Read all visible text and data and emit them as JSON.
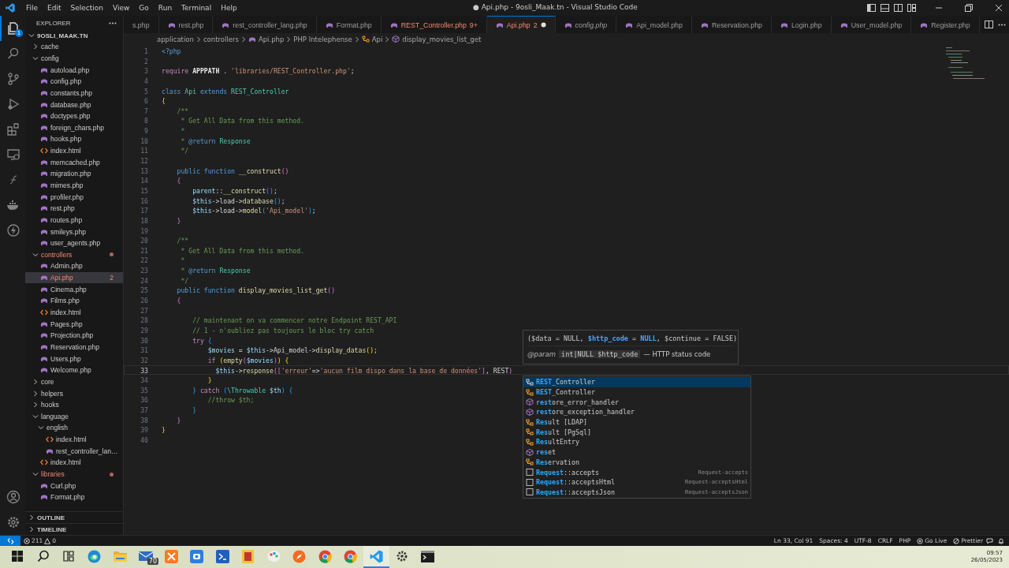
{
  "window": {
    "title": "● Api.php - 9osli_Maak.tn - Visual Studio Code",
    "menu": [
      "File",
      "Edit",
      "Selection",
      "View",
      "Go",
      "Run",
      "Terminal",
      "Help"
    ]
  },
  "activity_bar": [
    {
      "kind": "explorer",
      "selected": true,
      "badge": "1"
    },
    {
      "kind": "search",
      "selected": false
    },
    {
      "kind": "source-control",
      "selected": false
    },
    {
      "kind": "run",
      "selected": false
    },
    {
      "kind": "extensions",
      "selected": false
    },
    {
      "kind": "remote",
      "selected": false
    },
    {
      "kind": "script",
      "selected": false
    },
    {
      "kind": "docker",
      "selected": false
    },
    {
      "kind": "bolt",
      "selected": false
    }
  ],
  "activity_bottom": [
    {
      "kind": "account"
    },
    {
      "kind": "settings"
    }
  ],
  "explorer": {
    "title": "EXPLORER",
    "root": {
      "label": "9OSLI_MAAK.TN",
      "expanded": true
    },
    "tree": [
      {
        "label": "cache",
        "kind": "folder",
        "expanded": false,
        "selected": false,
        "error": false
      },
      {
        "label": "config",
        "kind": "folder",
        "expanded": true,
        "selected": false,
        "error": false,
        "children": [
          {
            "label": "autoload.php",
            "kind": "php",
            "selected": false,
            "error": false
          },
          {
            "label": "config.php",
            "kind": "php",
            "selected": false,
            "error": false
          },
          {
            "label": "constants.php",
            "kind": "php",
            "selected": false,
            "error": false
          },
          {
            "label": "database.php",
            "kind": "php",
            "selected": false,
            "error": false
          },
          {
            "label": "doctypes.php",
            "kind": "php",
            "selected": false,
            "error": false
          },
          {
            "label": "foreign_chars.php",
            "kind": "php",
            "selected": false,
            "error": false
          },
          {
            "label": "hooks.php",
            "kind": "php",
            "selected": false,
            "error": false
          },
          {
            "label": "index.html",
            "kind": "html",
            "selected": false,
            "error": false
          },
          {
            "label": "memcached.php",
            "kind": "php",
            "selected": false,
            "error": false
          },
          {
            "label": "migration.php",
            "kind": "php",
            "selected": false,
            "error": false
          },
          {
            "label": "mimes.php",
            "kind": "php",
            "selected": false,
            "error": false
          },
          {
            "label": "profiler.php",
            "kind": "php",
            "selected": false,
            "error": false
          },
          {
            "label": "rest.php",
            "kind": "php",
            "selected": false,
            "error": false
          },
          {
            "label": "routes.php",
            "kind": "php",
            "selected": false,
            "error": false
          },
          {
            "label": "smileys.php",
            "kind": "php",
            "selected": false,
            "error": false
          },
          {
            "label": "user_agents.php",
            "kind": "php",
            "selected": false,
            "error": false
          }
        ]
      },
      {
        "label": "controllers",
        "kind": "folder",
        "expanded": true,
        "selected": false,
        "error": true,
        "children": [
          {
            "label": "Admin.php",
            "kind": "php",
            "selected": false,
            "error": false
          },
          {
            "label": "Api.php",
            "kind": "php",
            "selected": true,
            "error": true,
            "badge": "2"
          },
          {
            "label": "Cinema.php",
            "kind": "php",
            "selected": false,
            "error": false
          },
          {
            "label": "Films.php",
            "kind": "php",
            "selected": false,
            "error": false
          },
          {
            "label": "index.html",
            "kind": "html",
            "selected": false,
            "error": false
          },
          {
            "label": "Pages.php",
            "kind": "php",
            "selected": false,
            "error": false
          },
          {
            "label": "Projection.php",
            "kind": "php",
            "selected": false,
            "error": false
          },
          {
            "label": "Reservation.php",
            "kind": "php",
            "selected": false,
            "error": false
          },
          {
            "label": "Users.php",
            "kind": "php",
            "selected": false,
            "error": false
          },
          {
            "label": "Welcome.php",
            "kind": "php",
            "selected": false,
            "error": false
          }
        ]
      },
      {
        "label": "core",
        "kind": "folder",
        "expanded": false,
        "selected": false,
        "error": false
      },
      {
        "label": "helpers",
        "kind": "folder",
        "expanded": false,
        "selected": false,
        "error": false
      },
      {
        "label": "hooks",
        "kind": "folder",
        "expanded": false,
        "selected": false,
        "error": false
      },
      {
        "label": "language",
        "kind": "folder",
        "expanded": true,
        "selected": false,
        "error": false,
        "children": [
          {
            "label": "english",
            "kind": "folder",
            "expanded": true,
            "selected": false,
            "error": false,
            "children": [
              {
                "label": "index.html",
                "kind": "html",
                "selected": false,
                "error": false
              },
              {
                "label": "rest_controller_lan…",
                "kind": "php",
                "selected": false,
                "error": false
              }
            ]
          },
          {
            "label": "index.html",
            "kind": "html",
            "selected": false,
            "error": false
          }
        ]
      },
      {
        "label": "libraries",
        "kind": "folder",
        "expanded": true,
        "selected": false,
        "error": true,
        "children": [
          {
            "label": "Curl.php",
            "kind": "php",
            "selected": false,
            "error": false
          },
          {
            "label": "Format.php",
            "kind": "php",
            "selected": false,
            "error": false
          }
        ]
      }
    ],
    "sections": [
      {
        "label": "OUTLINE",
        "expanded": false
      },
      {
        "label": "TIMELINE",
        "expanded": false
      }
    ]
  },
  "tabs": [
    {
      "label": "s.php",
      "icon": false,
      "selected": false,
      "preview": false,
      "error": false,
      "modified": false
    },
    {
      "label": "rest.php",
      "icon": true,
      "selected": false,
      "preview": false,
      "error": false,
      "modified": false
    },
    {
      "label": "rest_controller_lang.php",
      "icon": true,
      "selected": false,
      "preview": false,
      "error": false,
      "modified": false
    },
    {
      "label": "Format.php",
      "icon": true,
      "selected": false,
      "preview": false,
      "error": false,
      "modified": false
    },
    {
      "label": "REST_Controller.php",
      "icon": true,
      "selected": false,
      "preview": false,
      "error": true,
      "badge": "9+",
      "modified": false
    },
    {
      "label": "Api.php",
      "icon": true,
      "selected": true,
      "preview": false,
      "error": true,
      "badge": "2",
      "modified": true
    },
    {
      "label": "config.php",
      "icon": true,
      "selected": false,
      "preview": true,
      "error": false,
      "modified": false
    },
    {
      "label": "Api_model.php",
      "icon": true,
      "selected": false,
      "preview": false,
      "error": false,
      "modified": false
    },
    {
      "label": "Reservation.php",
      "icon": true,
      "selected": false,
      "preview": false,
      "error": false,
      "modified": false
    },
    {
      "label": "Login.php",
      "icon": true,
      "selected": false,
      "preview": false,
      "error": false,
      "modified": false
    },
    {
      "label": "User_model.php",
      "icon": true,
      "selected": false,
      "preview": false,
      "error": false,
      "modified": false
    },
    {
      "label": "Register.php",
      "icon": true,
      "selected": false,
      "preview": false,
      "error": false,
      "modified": false
    }
  ],
  "breadcrumb": [
    {
      "text": "application",
      "kind": "folder"
    },
    {
      "text": "controllers",
      "kind": "folder"
    },
    {
      "text": "Api.php",
      "kind": "php"
    },
    {
      "text": "PHP Intelephense",
      "kind": "folder"
    },
    {
      "text": "Api",
      "kind": "class"
    },
    {
      "text": "display_movies_list_get",
      "kind": "method"
    }
  ],
  "lines": [
    {
      "number": "1",
      "current": false,
      "tokens": [
        {
          "kind": "tag",
          "text": "<?php"
        }
      ]
    },
    {
      "number": "2",
      "current": false
    },
    {
      "number": "3",
      "current": false,
      "tokens": [
        {
          "kind": "control",
          "text": "require "
        },
        {
          "kind": "const",
          "text": "APPPATH"
        },
        {
          "kind": "plain",
          "text": " . "
        },
        {
          "kind": "string",
          "text": "'libraries/REST_Controller.php'"
        },
        {
          "kind": "plain",
          "text": ";"
        }
      ]
    },
    {
      "number": "4",
      "current": false
    },
    {
      "number": "5",
      "current": false,
      "tokens": [
        {
          "kind": "keyword",
          "text": "class "
        },
        {
          "kind": "class",
          "text": "Api "
        },
        {
          "kind": "keyword",
          "text": "extends "
        },
        {
          "kind": "class",
          "text": "REST_Controller"
        }
      ]
    },
    {
      "number": "6",
      "current": false,
      "tokens": [
        {
          "kind": "bracket1",
          "text": "{"
        }
      ]
    },
    {
      "number": "7",
      "current": false,
      "tokens": [
        {
          "kind": "comment",
          "text": "    /**"
        }
      ]
    },
    {
      "number": "8",
      "current": false,
      "tokens": [
        {
          "kind": "comment",
          "text": "     * Get All Data from this method."
        }
      ]
    },
    {
      "number": "9",
      "current": false,
      "tokens": [
        {
          "kind": "comment",
          "text": "     *"
        }
      ]
    },
    {
      "number": "10",
      "current": false,
      "tokens": [
        {
          "kind": "comment",
          "text": "     * "
        },
        {
          "kind": "doctag",
          "text": "@return "
        },
        {
          "kind": "class",
          "text": "Response"
        }
      ]
    },
    {
      "number": "11",
      "current": false,
      "tokens": [
        {
          "kind": "comment",
          "text": "     */"
        }
      ]
    },
    {
      "number": "12",
      "current": false
    },
    {
      "number": "13",
      "current": false,
      "tokens": [
        {
          "kind": "keyword",
          "text": "    public function "
        },
        {
          "kind": "function",
          "text": "__construct"
        },
        {
          "kind": "bracket2",
          "text": "()"
        }
      ]
    },
    {
      "number": "14",
      "current": false,
      "tokens": [
        {
          "kind": "bracket2",
          "text": "    {"
        }
      ]
    },
    {
      "number": "15",
      "current": false,
      "tokens": [
        {
          "kind": "variable",
          "text": "        parent"
        },
        {
          "kind": "plain",
          "text": "::"
        },
        {
          "kind": "function",
          "text": "__construct"
        },
        {
          "kind": "bracket3",
          "text": "()"
        },
        {
          "kind": "plain",
          "text": ";"
        }
      ]
    },
    {
      "number": "16",
      "current": false,
      "tokens": [
        {
          "kind": "variable",
          "text": "        $this"
        },
        {
          "kind": "plain",
          "text": "->load->"
        },
        {
          "kind": "function",
          "text": "database"
        },
        {
          "kind": "bracket3",
          "text": "()"
        },
        {
          "kind": "plain",
          "text": ";"
        }
      ]
    },
    {
      "number": "17",
      "current": false,
      "tokens": [
        {
          "kind": "variable",
          "text": "        $this"
        },
        {
          "kind": "plain",
          "text": "->load->"
        },
        {
          "kind": "function",
          "text": "model"
        },
        {
          "kind": "bracket3",
          "text": "("
        },
        {
          "kind": "string",
          "text": "'Api_model'"
        },
        {
          "kind": "bracket3",
          "text": ")"
        },
        {
          "kind": "plain",
          "text": ";"
        }
      ]
    },
    {
      "number": "18",
      "current": false,
      "tokens": [
        {
          "kind": "bracket2",
          "text": "    }"
        }
      ]
    },
    {
      "number": "19",
      "current": false
    },
    {
      "number": "20",
      "current": false,
      "tokens": [
        {
          "kind": "comment",
          "text": "    /**"
        }
      ]
    },
    {
      "number": "21",
      "current": false,
      "tokens": [
        {
          "kind": "comment",
          "text": "     * Get All Data from this method."
        }
      ]
    },
    {
      "number": "22",
      "current": false,
      "tokens": [
        {
          "kind": "comment",
          "text": "     *"
        }
      ]
    },
    {
      "number": "23",
      "current": false,
      "tokens": [
        {
          "kind": "comment",
          "text": "     * "
        },
        {
          "kind": "doctag",
          "text": "@return "
        },
        {
          "kind": "class",
          "text": "Response"
        }
      ]
    },
    {
      "number": "24",
      "current": false,
      "tokens": [
        {
          "kind": "comment",
          "text": "     */"
        }
      ]
    },
    {
      "number": "25",
      "current": false,
      "tokens": [
        {
          "kind": "keyword",
          "text": "    public function "
        },
        {
          "kind": "function",
          "text": "display_movies_list_get"
        },
        {
          "kind": "bracket2",
          "text": "()"
        }
      ]
    },
    {
      "number": "26",
      "current": false,
      "tokens": [
        {
          "kind": "bracket2",
          "text": "    {"
        }
      ]
    },
    {
      "number": "27",
      "current": false
    },
    {
      "number": "28",
      "current": false,
      "tokens": [
        {
          "kind": "comment",
          "text": "        // maintenant on va commencer notre Endpoint REST_API"
        }
      ]
    },
    {
      "number": "29",
      "current": false,
      "tokens": [
        {
          "kind": "comment",
          "text": "        // 1 - n'oubliez pas toujours le bloc try catch"
        }
      ]
    },
    {
      "number": "30",
      "current": false,
      "tokens": [
        {
          "kind": "control",
          "text": "        try "
        },
        {
          "kind": "bracket3",
          "text": "{"
        }
      ]
    },
    {
      "number": "31",
      "current": false,
      "tokens": [
        {
          "kind": "variable",
          "text": "            $movies"
        },
        {
          "kind": "plain",
          "text": " = "
        },
        {
          "kind": "variable",
          "text": "$this"
        },
        {
          "kind": "plain",
          "text": "->Api_model->"
        },
        {
          "kind": "function",
          "text": "display_datas"
        },
        {
          "kind": "bracket1",
          "text": "()"
        },
        {
          "kind": "plain",
          "text": ";"
        }
      ]
    },
    {
      "number": "32",
      "current": false,
      "tokens": [
        {
          "kind": "control",
          "text": "            if "
        },
        {
          "kind": "bracket1",
          "text": "("
        },
        {
          "kind": "function",
          "text": "empty"
        },
        {
          "kind": "bracket2",
          "text": "("
        },
        {
          "kind": "variable",
          "text": "$movies"
        },
        {
          "kind": "bracket2",
          "text": ")"
        },
        {
          "kind": "bracket1",
          "text": ") {"
        }
      ]
    },
    {
      "number": "33",
      "current": true,
      "tokens": [
        {
          "kind": "variable",
          "text": "              $this"
        },
        {
          "kind": "plain",
          "text": "->"
        },
        {
          "kind": "function",
          "text": "response"
        },
        {
          "kind": "bracket2",
          "text": "(["
        },
        {
          "kind": "string",
          "text": "'erreur'"
        },
        {
          "kind": "plain",
          "text": "=>"
        },
        {
          "kind": "string",
          "text": "'aucun film dispo dans la base de données'"
        },
        {
          "kind": "bracket2",
          "text": "]"
        },
        {
          "kind": "plain",
          "text": ", REST"
        },
        {
          "kind": "bracket2",
          "text": ")"
        }
      ]
    },
    {
      "number": "34",
      "current": false,
      "tokens": [
        {
          "kind": "bracket1",
          "text": "            }"
        }
      ]
    },
    {
      "number": "35",
      "current": false,
      "tokens": [
        {
          "kind": "bracket3",
          "text": "        }"
        },
        {
          "kind": "control",
          "text": " catch "
        },
        {
          "kind": "bracket3",
          "text": "("
        },
        {
          "kind": "class",
          "text": "\\Throwable "
        },
        {
          "kind": "variable",
          "text": "$th"
        },
        {
          "kind": "bracket3",
          "text": ") {"
        }
      ]
    },
    {
      "number": "36",
      "current": false,
      "tokens": [
        {
          "kind": "comment",
          "text": "            //throw $th;"
        }
      ]
    },
    {
      "number": "37",
      "current": false,
      "tokens": [
        {
          "kind": "bracket3",
          "text": "        }"
        }
      ]
    },
    {
      "number": "38",
      "current": false,
      "tokens": [
        {
          "kind": "bracket2",
          "text": "    }"
        }
      ]
    },
    {
      "number": "39",
      "current": false,
      "tokens": [
        {
          "kind": "bracket1",
          "text": "}"
        }
      ]
    },
    {
      "number": "40",
      "current": false
    }
  ],
  "hover": {
    "signature": [
      {
        "kind": "plain",
        "text": "($data = NULL, "
      },
      {
        "kind": "active",
        "text": "$http_code"
      },
      {
        "kind": "plain",
        "text": " = "
      },
      {
        "kind": "active",
        "text": "NULL"
      },
      {
        "kind": "plain",
        "text": ", $continue = FALSE)"
      }
    ],
    "param_tag": "@param",
    "param_code": "int|NULL $http_code",
    "param_doc": "— HTTP status code"
  },
  "suggestions": [
    {
      "kind": "class-alt",
      "match": "REST",
      "rest": "_Controller",
      "selected": true
    },
    {
      "kind": "class",
      "match": "REST",
      "rest": "_Controller",
      "selected": false
    },
    {
      "kind": "function",
      "match": "rest",
      "rest": "ore_error_handler",
      "selected": false
    },
    {
      "kind": "function",
      "match": "rest",
      "rest": "ore_exception_handler",
      "selected": false
    },
    {
      "kind": "class",
      "match": "Res",
      "rest": "ult [LDAP]",
      "selected": false
    },
    {
      "kind": "class",
      "match": "Res",
      "rest": "ult [PgSql]",
      "selected": false
    },
    {
      "kind": "class",
      "match": "Res",
      "rest": "ultEntry",
      "selected": false
    },
    {
      "kind": "function",
      "match": "res",
      "rest": "et",
      "selected": false
    },
    {
      "kind": "class",
      "match": "Res",
      "rest": "ervation",
      "selected": false
    },
    {
      "kind": "method",
      "match": "Request",
      "rest": "::accepts",
      "detail": "Request-accepts",
      "selected": false
    },
    {
      "kind": "method",
      "match": "Request",
      "rest": "::acceptsHtml",
      "detail": "Request-acceptsHtml",
      "selected": false
    },
    {
      "kind": "method",
      "match": "Request",
      "rest": "::acceptsJson",
      "detail": "Request-acceptsJson",
      "selected": false
    }
  ],
  "status_bar": {
    "errors": "211",
    "warnings": "0",
    "items": [
      {
        "kind": "plain",
        "text": "Ln 33, Col 91"
      },
      {
        "kind": "plain",
        "text": "Spaces: 4"
      },
      {
        "kind": "plain",
        "text": "UTF-8"
      },
      {
        "kind": "plain",
        "text": "CRLF"
      },
      {
        "kind": "plain",
        "text": "PHP"
      },
      {
        "kind": "live",
        "text": "Go Live"
      },
      {
        "kind": "prettier",
        "text": "Prettier"
      }
    ]
  },
  "taskbar": {
    "apps": [
      {
        "kind": "start",
        "selected": false
      },
      {
        "kind": "search",
        "selected": false
      },
      {
        "kind": "taskview",
        "selected": false
      },
      {
        "kind": "browser",
        "selected": false
      },
      {
        "kind": "folder",
        "selected": false
      },
      {
        "kind": "mail",
        "selected": false,
        "badge": "70"
      },
      {
        "kind": "orange",
        "selected": false
      },
      {
        "kind": "blue",
        "selected": false
      },
      {
        "kind": "terminal",
        "selected": false
      },
      {
        "kind": "yellow",
        "selected": false
      },
      {
        "kind": "paint",
        "selected": false
      },
      {
        "kind": "compass",
        "selected": false
      },
      {
        "kind": "chrome",
        "selected": false
      },
      {
        "kind": "chrome",
        "selected": false
      },
      {
        "kind": "code",
        "selected": true
      },
      {
        "kind": "gear",
        "selected": false
      },
      {
        "kind": "console",
        "selected": false
      }
    ],
    "time": "09:57",
    "date": "26/05/2023"
  }
}
